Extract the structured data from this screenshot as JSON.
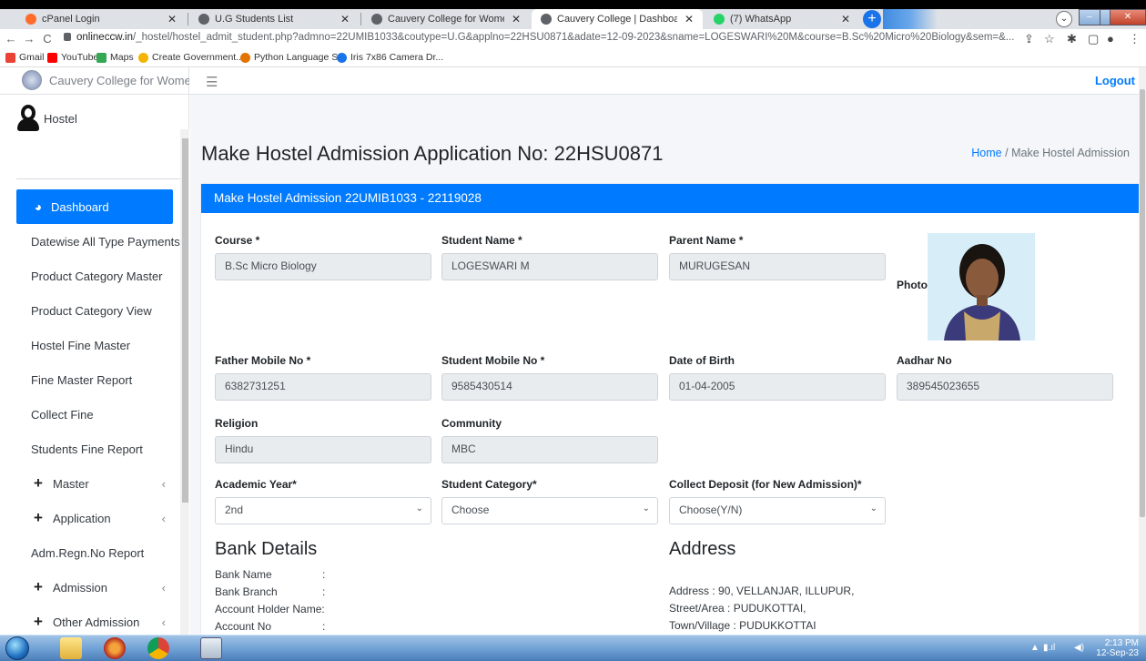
{
  "browser": {
    "tabs": [
      {
        "label": "cPanel Login",
        "fav": "#ff6c2c"
      },
      {
        "label": "U.G Students List",
        "fav": "#5f6368"
      },
      {
        "label": "Cauvery College for Women",
        "fav": "#5f6368"
      },
      {
        "label": "Cauvery College | Dashboard",
        "fav": "#5f6368"
      },
      {
        "label": "(7) WhatsApp",
        "fav": "#25d366"
      }
    ],
    "url_host": "onlineccw.in",
    "url_path": "/_hostel/hostel_admit_student.php?admno=22UMIB1033&coutype=U.G&applno=22HSU0871&adate=12-09-2023&sname=LOGESWARI%20M&course=B.Sc%20Micro%20Biology&sem=&...",
    "bookmarks": [
      {
        "label": "Gmail",
        "color": "#ea4335"
      },
      {
        "label": "YouTube",
        "color": "#ff0000"
      },
      {
        "label": "Maps",
        "color": "#34a853"
      },
      {
        "label": "Create Government...",
        "color": "#f4b400"
      },
      {
        "label": "Python Language S...",
        "color": "#e37400"
      },
      {
        "label": "Iris 7x86 Camera Dr...",
        "color": "#1a73e8"
      }
    ]
  },
  "app": {
    "brand": "Cauvery College for Women",
    "user": "Hostel",
    "logout": "Logout",
    "nav": [
      {
        "label": "Dashboard",
        "active": true
      },
      {
        "label": "Datewise All Type Payments"
      },
      {
        "label": "Product Category Master"
      },
      {
        "label": "Product Category View"
      },
      {
        "label": "Hostel Fine Master"
      },
      {
        "label": "Fine Master Report"
      },
      {
        "label": "Collect Fine"
      },
      {
        "label": "Students Fine Report"
      },
      {
        "label": "Master",
        "expandable": true
      },
      {
        "label": "Application",
        "expandable": true
      },
      {
        "label": "Adm.Regn.No Report"
      },
      {
        "label": "Admission",
        "expandable": true
      },
      {
        "label": "Other Admission",
        "expandable": true
      }
    ]
  },
  "page": {
    "title": "Make Hostel Admission Application No: 22HSU0871",
    "breadcrumb_home": "Home",
    "breadcrumb_sep": "/",
    "breadcrumb_current": "Make Hostel Admission",
    "card_header": "Make Hostel Admission 22UMIB1033 - 22119028",
    "fields": {
      "course": {
        "label": "Course *",
        "value": "B.Sc Micro Biology"
      },
      "student_name": {
        "label": "Student Name *",
        "value": "LOGESWARI M"
      },
      "parent_name": {
        "label": "Parent Name *",
        "value": "MURUGESAN"
      },
      "photo": {
        "label": "Photo"
      },
      "father_mobile": {
        "label": "Father Mobile No *",
        "value": "6382731251"
      },
      "student_mobile": {
        "label": "Student Mobile No *",
        "value": "9585430514"
      },
      "dob": {
        "label": "Date of Birth",
        "value": "01-04-2005"
      },
      "aadhar": {
        "label": "Aadhar No",
        "value": "389545023655"
      },
      "religion": {
        "label": "Religion",
        "value": "Hindu"
      },
      "community": {
        "label": "Community",
        "value": "MBC"
      },
      "academic_year": {
        "label": "Academic Year*",
        "value": "2nd"
      },
      "student_category": {
        "label": "Student Category*",
        "value": "Choose"
      },
      "collect_deposit": {
        "label": "Collect Deposit (for New Admission)*",
        "value": "Choose(Y/N)"
      }
    },
    "bank": {
      "title": "Bank Details",
      "rows": [
        {
          "key": "Bank Name",
          "sep": ":"
        },
        {
          "key": "Bank Branch",
          "sep": ":"
        },
        {
          "key": "Account Holder Name",
          "sep": ":"
        },
        {
          "key": "Account No",
          "sep": ":"
        }
      ]
    },
    "address": {
      "title": "Address",
      "lines": [
        "Address : 90, VELLANJAR, ILLUPUR,",
        "Street/Area : PUDUKOTTAI,",
        "Town/Village : PUDUKKOTTAI"
      ]
    }
  },
  "taskbar": {
    "time": "2:13 PM",
    "date": "12-Sep-23"
  }
}
